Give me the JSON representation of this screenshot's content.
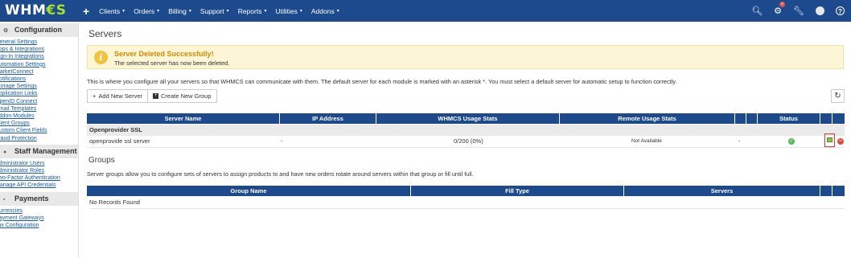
{
  "brand": {
    "logo_main": "WHM",
    "logo_accent": "€S"
  },
  "nav": {
    "plus": "+",
    "items": [
      "Clients",
      "Orders",
      "Billing",
      "Support",
      "Reports",
      "Utilities",
      "Addons"
    ],
    "caret": "▾"
  },
  "top_icons": {
    "search": "search-icon",
    "notifications_count": "x",
    "tools": "wrench-icon",
    "help": "?"
  },
  "sidebar": {
    "configuration": {
      "heading": "Configuration",
      "items": [
        "General Settings",
        "Apps & Integrations",
        "Sign-In Integrations",
        "Automation Settings",
        "MarketConnect",
        "Notifications",
        "Storage Settings",
        "Application Links",
        "OpenID Connect",
        "Email Templates",
        "Addon Modules",
        "Client Groups",
        "Custom Client Fields",
        "Fraud Protection"
      ]
    },
    "staff": {
      "heading": "Staff Management",
      "items": [
        "Administrator Users",
        "Administrator Roles",
        "Two-Factor Authentication",
        "Manage API Credentials"
      ]
    },
    "payments": {
      "heading": "Payments",
      "items": [
        "Currencies",
        "Payment Gateways",
        "Tax Configuration"
      ]
    }
  },
  "page": {
    "title": "Servers",
    "alert": {
      "title": "Server Deleted Successfully!",
      "message": "The selected server has now been deleted."
    },
    "intro": "This is where you configure all your servers so that WHMCS can communicate with them. The default server for each module is marked with an asterisk *. You must select a default server for automatic setup to function correctly.",
    "buttons": {
      "add_server": "Add New Server",
      "add_server_prefix": "+",
      "create_group": "Create New Group"
    }
  },
  "servers_table": {
    "headers": [
      "Server Name",
      "IP Address",
      "WHMCS Usage Stats",
      "Remote Usage Stats",
      "",
      "",
      "Status",
      "",
      ""
    ],
    "group": "Openprovider SSL",
    "row": {
      "name": "openprovide ssl server",
      "ip": "-",
      "usage": "0/200 (0%)",
      "remote": "Not Available",
      "extra": "-"
    }
  },
  "groups": {
    "title": "Groups",
    "intro": "Server groups allow you to configure sets of servers to assign products to and have new orders rotate around servers within that group or fill until full.",
    "headers": [
      "Group Name",
      "Fill Type",
      "Servers",
      "",
      ""
    ],
    "empty": "No Records Found"
  }
}
